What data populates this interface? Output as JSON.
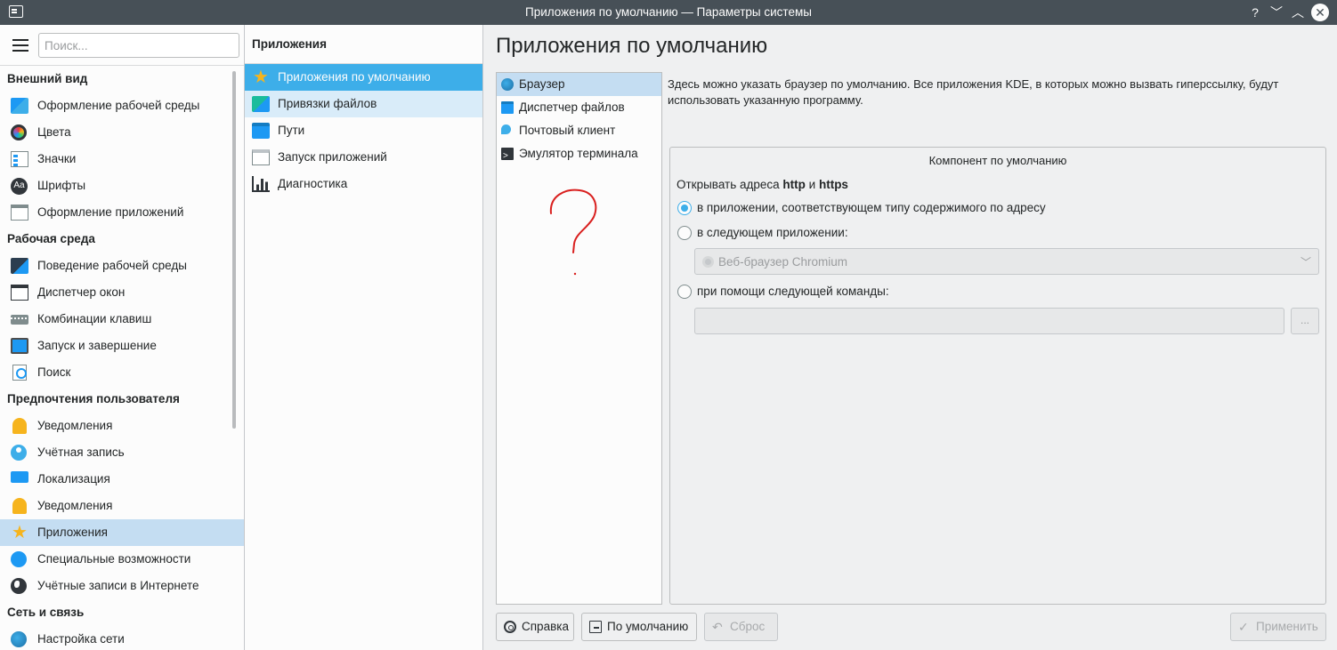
{
  "window": {
    "title": "Приложения по умолчанию — Параметры системы",
    "help_glyph": "?",
    "minimize_glyph": "﹀",
    "maximize_glyph": "︿",
    "close_glyph": "✕"
  },
  "sidebar": {
    "search_placeholder": "Поиск...",
    "categories": [
      {
        "label": "Внешний вид",
        "items": [
          {
            "label": "Оформление рабочей среды",
            "icon": "workspace-theme-icon"
          },
          {
            "label": "Цвета",
            "icon": "colors-icon"
          },
          {
            "label": "Значки",
            "icon": "icons-icon"
          },
          {
            "label": "Шрифты",
            "icon": "fonts-icon"
          },
          {
            "label": "Оформление приложений",
            "icon": "application-style-icon"
          }
        ]
      },
      {
        "label": "Рабочая среда",
        "items": [
          {
            "label": "Поведение рабочей среды",
            "icon": "workspace-behavior-icon"
          },
          {
            "label": "Диспетчер окон",
            "icon": "window-manager-icon"
          },
          {
            "label": "Комбинации клавиш",
            "icon": "keyboard-icon"
          },
          {
            "label": "Запуск и завершение",
            "icon": "startup-shutdown-icon"
          },
          {
            "label": "Поиск",
            "icon": "search-icon"
          }
        ]
      },
      {
        "label": "Предпочтения пользователя",
        "items": [
          {
            "label": "Уведомления",
            "icon": "bell-icon"
          },
          {
            "label": "Учётная запись",
            "icon": "user-icon"
          },
          {
            "label": "Локализация",
            "icon": "locale-icon"
          },
          {
            "label": "Уведомления",
            "icon": "bell-icon"
          },
          {
            "label": "Приложения",
            "icon": "star-icon",
            "active": true
          },
          {
            "label": "Специальные возможности",
            "icon": "accessibility-icon"
          },
          {
            "label": "Учётные записи в Интернете",
            "icon": "globe-icon"
          }
        ]
      },
      {
        "label": "Сеть и связь",
        "items": [
          {
            "label": "Настройка сети",
            "icon": "network-icon"
          }
        ]
      }
    ]
  },
  "midpanel": {
    "title": "Приложения",
    "items": [
      {
        "label": "Приложения по умолчанию",
        "icon": "star-icon",
        "state": "active"
      },
      {
        "label": "Привязки файлов",
        "icon": "file-associations-icon",
        "state": "hover"
      },
      {
        "label": "Пути",
        "icon": "folder-icon"
      },
      {
        "label": "Запуск приложений",
        "icon": "launch-feedback-icon"
      },
      {
        "label": "Диагностика",
        "icon": "diagnostics-icon"
      }
    ]
  },
  "main": {
    "title": "Приложения по умолчанию",
    "components": [
      {
        "label": "Браузер",
        "icon": "browser-icon",
        "active": true
      },
      {
        "label": "Диспетчер файлов",
        "icon": "file-manager-icon"
      },
      {
        "label": "Почтовый клиент",
        "icon": "mail-client-icon"
      },
      {
        "label": "Эмулятор терминала",
        "icon": "terminal-icon"
      }
    ],
    "annotation": "?",
    "description": "Здесь можно указать браузер по умолчанию. Все приложения KDE, в которых можно вызвать гиперссылку, будут использовать указанную программу.",
    "group": {
      "title": "Компонент по умолчанию",
      "open_prefix": "Открывать адреса ",
      "open_http": "http",
      "open_and": " и ",
      "open_https": "https",
      "option_mime": "в приложении, соответствующем типу содержимого по адресу",
      "option_app": "в следующем приложении:",
      "app_combo_value": "Веб-браузер Chromium",
      "option_command": "при помощи следующей команды:",
      "command_value": "",
      "browse_label": "..."
    },
    "selected_option": "mime"
  },
  "buttons": {
    "help": "Справка",
    "defaults": "По умолчанию",
    "reset": "Сброс",
    "apply": "Применить",
    "reset_glyph": "↶",
    "apply_glyph": "✓"
  }
}
